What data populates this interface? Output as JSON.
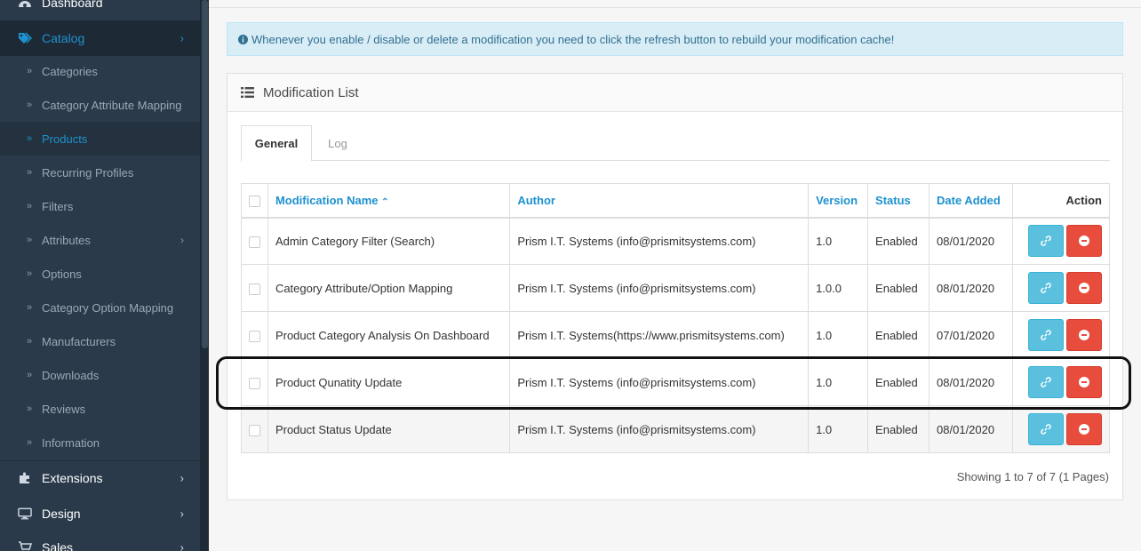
{
  "sidebar": {
    "top_items": [
      {
        "label": "Dashboard",
        "icon": "dashboard-icon"
      },
      {
        "label": "Catalog",
        "icon": "tags-icon"
      },
      {
        "label": "Extensions",
        "icon": "puzzle-icon"
      },
      {
        "label": "Design",
        "icon": "monitor-icon"
      },
      {
        "label": "Sales",
        "icon": "cart-icon"
      }
    ],
    "catalog_items": [
      {
        "label": "Categories"
      },
      {
        "label": "Category Attribute Mapping"
      },
      {
        "label": "Products"
      },
      {
        "label": "Recurring Profiles"
      },
      {
        "label": "Filters"
      },
      {
        "label": "Attributes"
      },
      {
        "label": "Options"
      },
      {
        "label": "Category Option Mapping"
      },
      {
        "label": "Manufacturers"
      },
      {
        "label": "Downloads"
      },
      {
        "label": "Reviews"
      },
      {
        "label": "Information"
      }
    ]
  },
  "alert": {
    "text": "Whenever you enable / disable or delete a modification you need to click the refresh button to rebuild your modification cache!"
  },
  "panel": {
    "title": "Modification List"
  },
  "tabs": [
    {
      "label": "General"
    },
    {
      "label": "Log"
    }
  ],
  "table": {
    "columns": {
      "name": "Modification Name",
      "author": "Author",
      "version": "Version",
      "status": "Status",
      "date": "Date Added",
      "action": "Action"
    },
    "rows": [
      {
        "name": "Admin Category Filter (Search)",
        "author": "Prism I.T. Systems (info@prismitsystems.com)",
        "version": "1.0",
        "status": "Enabled",
        "date": "08/01/2020"
      },
      {
        "name": "Category Attribute/Option Mapping",
        "author": "Prism I.T. Systems (info@prismitsystems.com)",
        "version": "1.0.0",
        "status": "Enabled",
        "date": "08/01/2020"
      },
      {
        "name": "Product Category Analysis On Dashboard",
        "author": "Prism I.T. Systems(https://www.prismitsystems.com)",
        "version": "1.0",
        "status": "Enabled",
        "date": "07/01/2020"
      },
      {
        "name": "Product Qunatity Update",
        "author": "Prism I.T. Systems (info@prismitsystems.com)",
        "version": "1.0",
        "status": "Enabled",
        "date": "08/01/2020"
      },
      {
        "name": "Product Status Update",
        "author": "Prism I.T. Systems (info@prismitsystems.com)",
        "version": "1.0",
        "status": "Enabled",
        "date": "08/01/2020"
      }
    ]
  },
  "pagination": {
    "info": "Showing 1 to 7 of 7 (1 Pages)"
  },
  "colors": {
    "sidebar_bg": "#2b3a4a",
    "accent": "#1e91cf",
    "info_button": "#5bc0de",
    "danger_button": "#e74c3c",
    "alert_bg": "#d9edf7"
  }
}
